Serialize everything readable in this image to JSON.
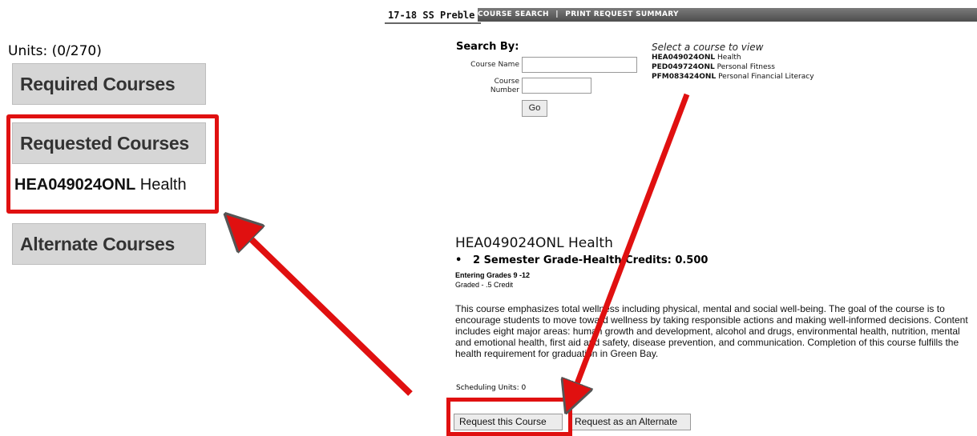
{
  "left_panel": {
    "units_label": "Units: (0/270)",
    "required_label": "Required Courses",
    "requested_label": "Requested Courses",
    "requested_item": {
      "code": "HEA049024ONL",
      "name": "Health"
    },
    "alternate_label": "Alternate Courses"
  },
  "topbar": {
    "title": "17-18 SS Preble",
    "links": [
      "COURSE SEARCH",
      "PRINT REQUEST SUMMARY"
    ],
    "separator": "|"
  },
  "search": {
    "title": "Search By:",
    "course_name_label": "Course Name",
    "course_name_value": "",
    "course_number_label_1": "Course",
    "course_number_label_2": "Number",
    "course_number_value": "",
    "go_label": "Go"
  },
  "course_list": {
    "title": "Select a course to view",
    "items": [
      {
        "code": "HEA049024ONL",
        "name": "Health"
      },
      {
        "code": "PED049724ONL",
        "name": "Personal Fitness"
      },
      {
        "code": "PFM083424ONL",
        "name": "Personal Financial Literacy"
      }
    ]
  },
  "detail": {
    "title": "HEA049024ONL Health",
    "bullet": "2 Semester Grade-Health Credits: 0.500",
    "grades": "Entering Grades 9 -12",
    "graded": "Graded - .5 Credit",
    "description": "This course emphasizes total wellness including physical, mental and social well-being. The goal of the course is to encourage students to move toward wellness by taking responsible actions and making well-informed decisions. Content includes eight major areas: human growth and development, alcohol and drugs, environmental health, nutrition, mental and emotional health, first aid and safety, disease prevention, and communication. Completion of this course fulfills the health requirement for graduation in Green Bay.",
    "scheduling_units": "Scheduling Units: 0",
    "request_label": "Request this Course",
    "alternate_label": "Request as an Alternate"
  },
  "colors": {
    "highlight": "#e01010",
    "button_bg": "#d6d6d6",
    "topbar_bg": "#5a5a5a"
  }
}
